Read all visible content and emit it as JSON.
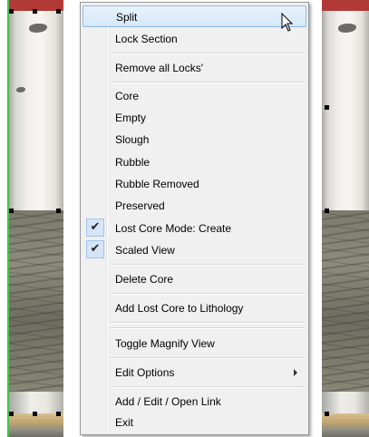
{
  "context_menu": {
    "items": [
      {
        "label": "Split",
        "highlighted": true
      },
      {
        "label": "Lock Section"
      },
      {
        "label": "Remove all Locks'"
      },
      {
        "label": "Core"
      },
      {
        "label": "Empty"
      },
      {
        "label": "Slough"
      },
      {
        "label": "Rubble"
      },
      {
        "label": "Rubble Removed"
      },
      {
        "label": "Preserved"
      },
      {
        "label": "Lost Core Mode: Create",
        "checked": true
      },
      {
        "label": "Scaled View",
        "checked": true
      },
      {
        "label": "Delete Core"
      },
      {
        "label": "Add Lost Core to Lithology"
      },
      {
        "label": "Toggle Magnify View"
      },
      {
        "label": "Edit Options",
        "has_submenu": true
      },
      {
        "label": "Add / Edit / Open Link"
      },
      {
        "label": "Exit"
      }
    ],
    "check_glyph": "✔"
  },
  "colors": {
    "highlight_border": "#8fb8e6",
    "menu_background": "#f0f0f0",
    "core_cap_red": "#b13a36"
  },
  "icons": {
    "pointer": "arrow-cursor-icon",
    "submenu": "chevron-right-icon",
    "check": "checkmark-icon"
  }
}
